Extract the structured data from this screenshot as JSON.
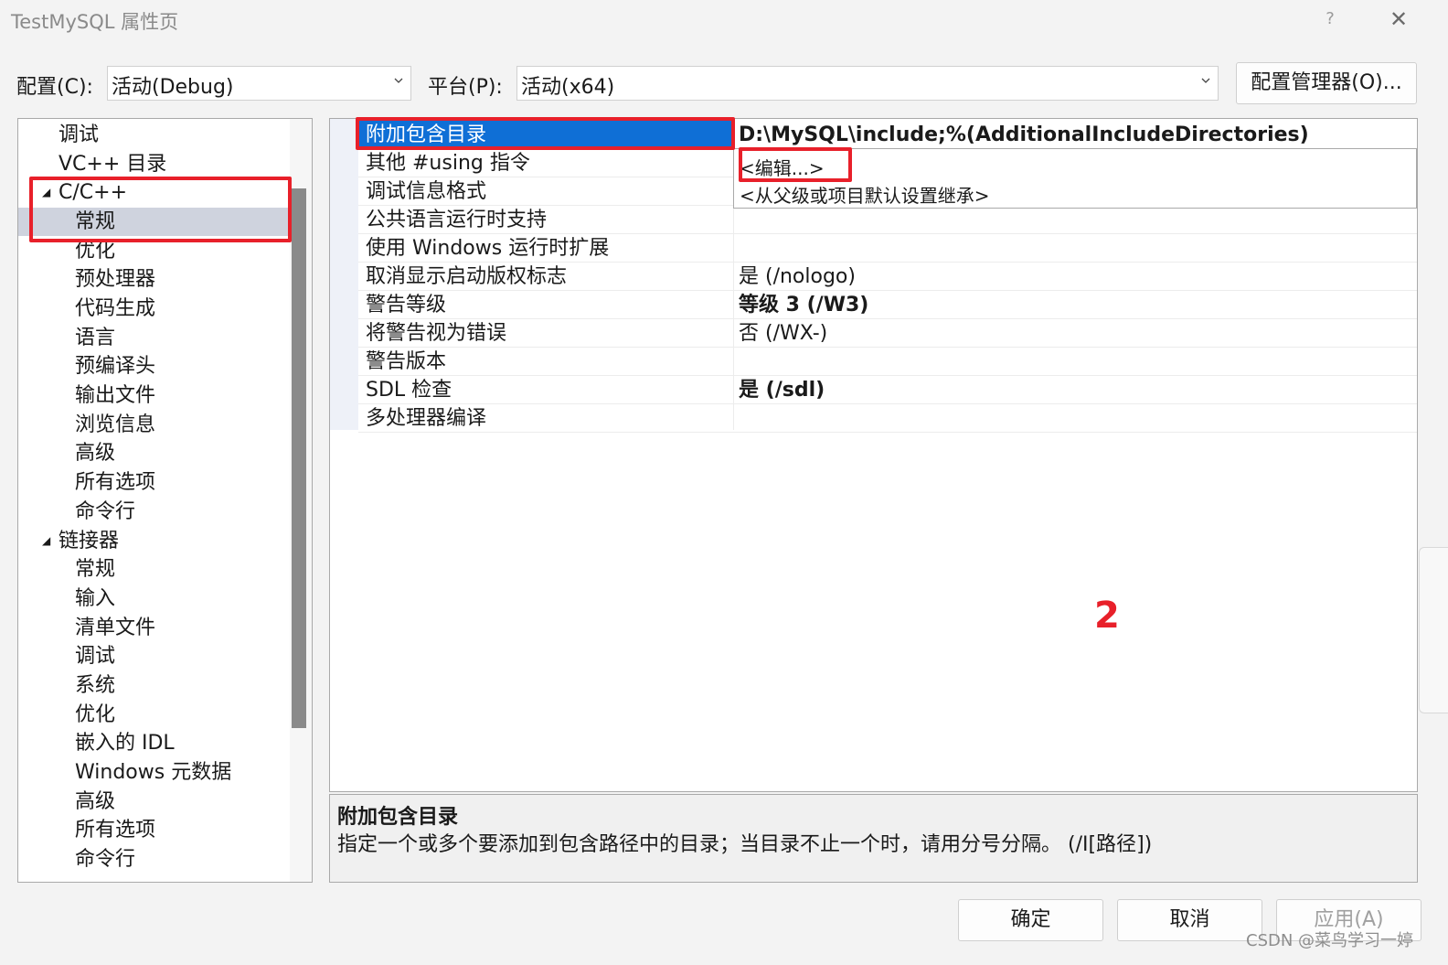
{
  "window": {
    "title": "TestMySQL 属性页",
    "help_glyph": "?",
    "close_glyph": "✕"
  },
  "toolbar": {
    "config_label": "配置(C):",
    "config_value": "活动(Debug)",
    "platform_label": "平台(P):",
    "platform_value": "活动(x64)",
    "config_manager_label": "配置管理器(O)..."
  },
  "tree": {
    "items": [
      {
        "label": "调试"
      },
      {
        "label": "VC++ 目录"
      },
      {
        "label": "C/C++"
      },
      {
        "label": "常规"
      },
      {
        "label": "优化"
      },
      {
        "label": "预处理器"
      },
      {
        "label": "代码生成"
      },
      {
        "label": "语言"
      },
      {
        "label": "预编译头"
      },
      {
        "label": "输出文件"
      },
      {
        "label": "浏览信息"
      },
      {
        "label": "高级"
      },
      {
        "label": "所有选项"
      },
      {
        "label": "命令行"
      },
      {
        "label": "链接器"
      },
      {
        "label": "常规"
      },
      {
        "label": "输入"
      },
      {
        "label": "清单文件"
      },
      {
        "label": "调试"
      },
      {
        "label": "系统"
      },
      {
        "label": "优化"
      },
      {
        "label": "嵌入的 IDL"
      },
      {
        "label": "Windows 元数据"
      },
      {
        "label": "高级"
      },
      {
        "label": "所有选项"
      },
      {
        "label": "命令行"
      }
    ],
    "expand_glyph": "◢"
  },
  "grid": {
    "rows": [
      {
        "name": "附加包含目录",
        "value": "D:\\MySQL\\include;%(AdditionalIncludeDirectories)"
      },
      {
        "name": "其他 #using 指令",
        "value": ""
      },
      {
        "name": "调试信息格式",
        "value": ""
      },
      {
        "name": "公共语言运行时支持",
        "value": ""
      },
      {
        "name": "使用 Windows 运行时扩展",
        "value": ""
      },
      {
        "name": "取消显示启动版权标志",
        "value": "是 (/nologo)"
      },
      {
        "name": "警告等级",
        "value": "等级 3 (/W3)"
      },
      {
        "name": "将警告视为错误",
        "value": "否 (/WX-)"
      },
      {
        "name": "警告版本",
        "value": ""
      },
      {
        "name": "SDL 检查",
        "value": "是 (/sdl)"
      },
      {
        "name": "多处理器编译",
        "value": ""
      }
    ],
    "dropdown_items": [
      "<编辑...>",
      "<从父级或项目默认设置继承>"
    ]
  },
  "annotation": {
    "number": "2",
    "color": "#e8202a"
  },
  "description": {
    "title": "附加包含目录",
    "text": "指定一个或多个要添加到包含路径中的目录；当目录不止一个时，请用分号分隔。      (/I[路径])"
  },
  "buttons": {
    "ok": "确定",
    "cancel": "取消",
    "apply": "应用(A)"
  },
  "watermark": "CSDN @菜鸟学习一婷",
  "colors": {
    "selection": "#0f6fd6",
    "tree_selection": "#cfd3de",
    "annotation_red": "#e8202a"
  }
}
